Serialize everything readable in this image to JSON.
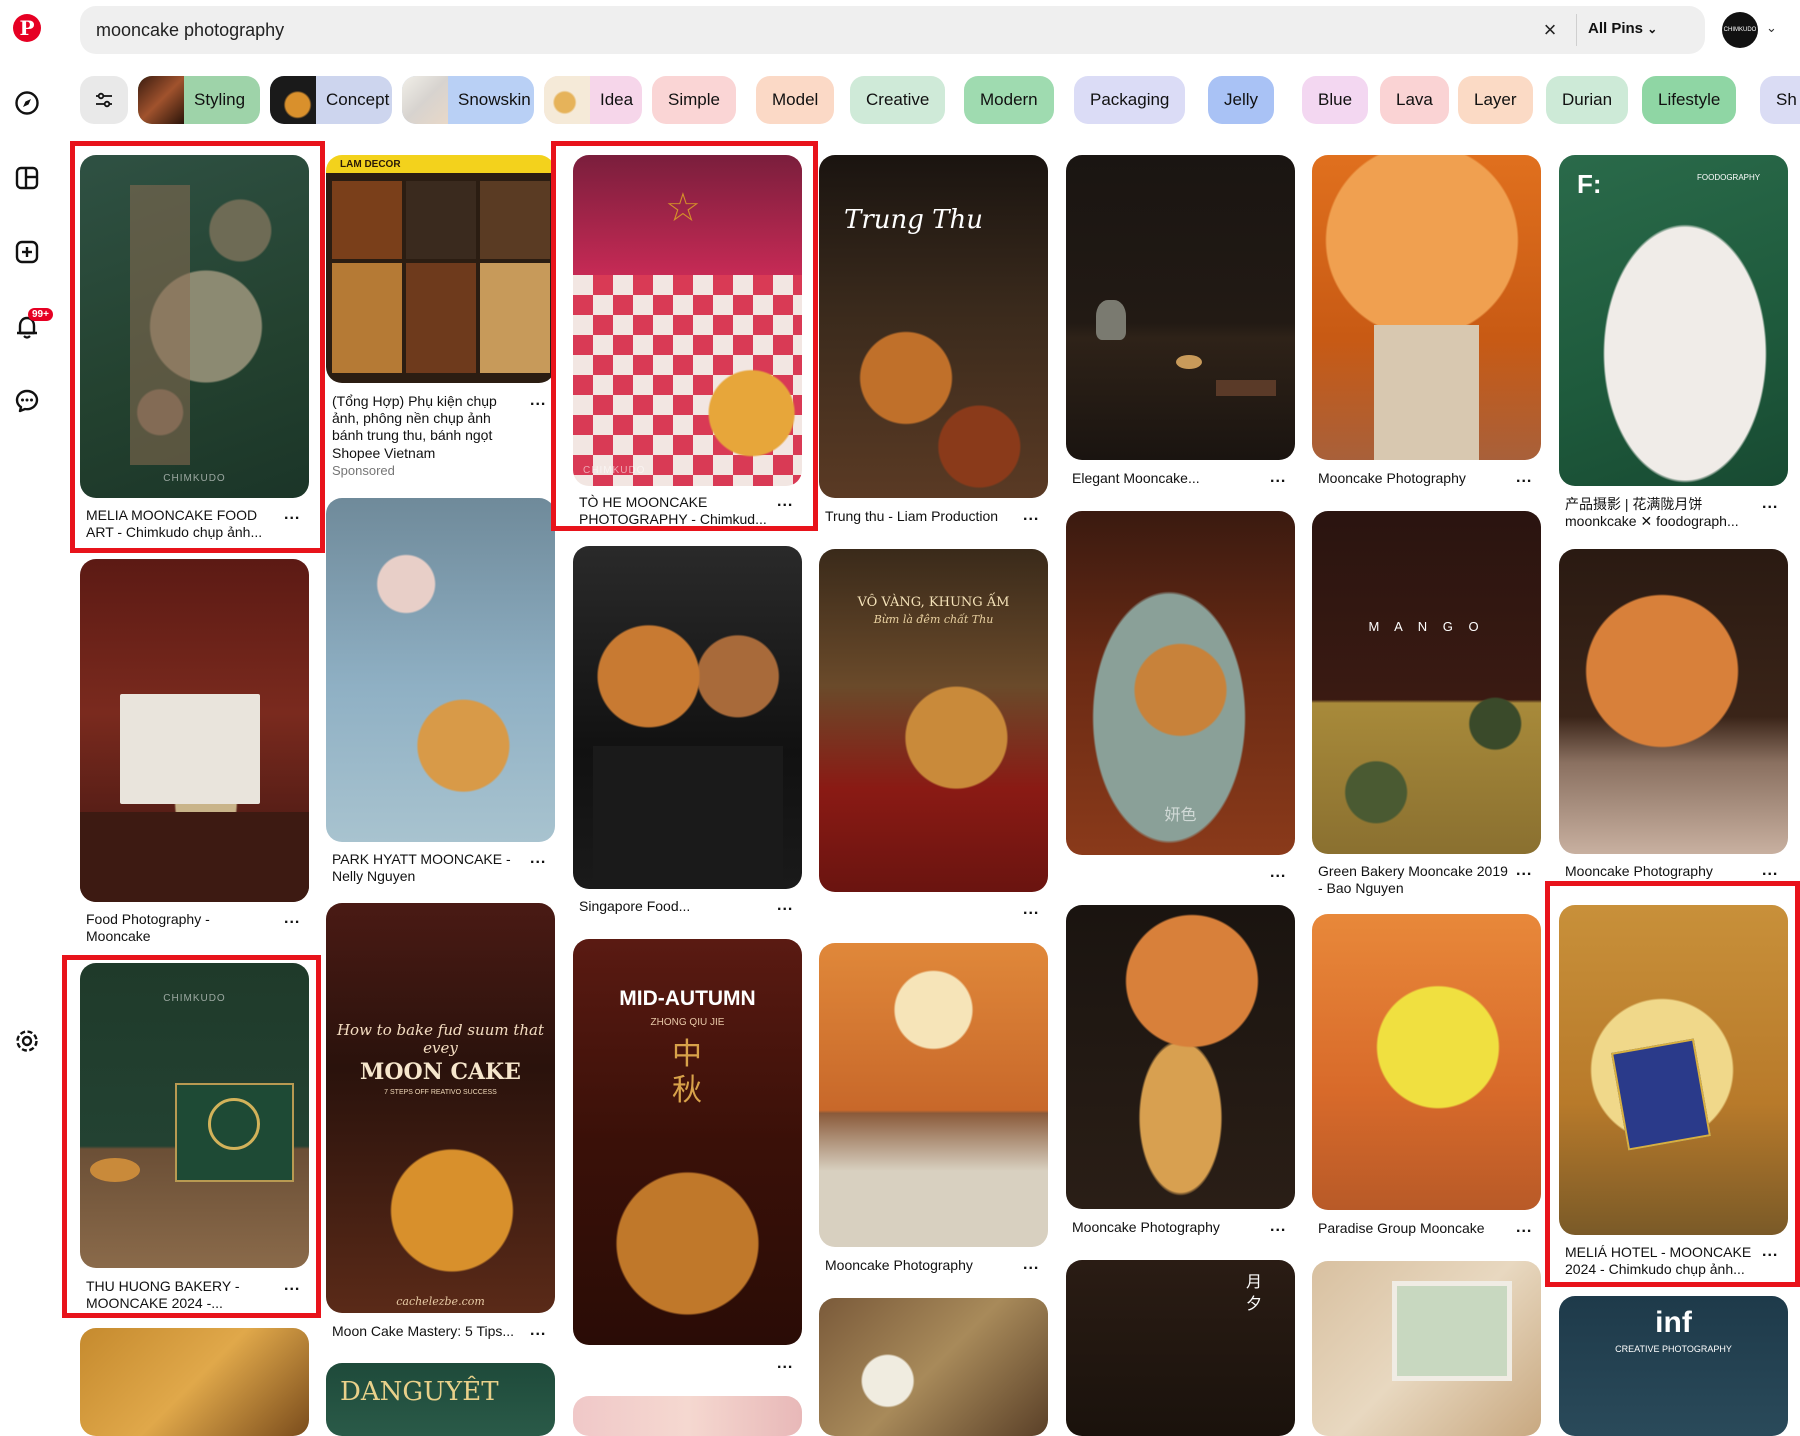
{
  "sidebar": {
    "logo": "P",
    "items": [
      "explore-icon",
      "boards-icon",
      "create-icon",
      "notifications-icon",
      "messages-icon",
      "settings-icon"
    ],
    "notification_badge": "99+"
  },
  "header": {
    "search_query": "mooncake photography",
    "clear_icon": "×",
    "filter_label": "All Pins",
    "avatar_text": "CHIMKUDO"
  },
  "chips": [
    {
      "label": "Styling",
      "color": "#9ed3a9"
    },
    {
      "label": "Concept",
      "color": "#cdd5ee"
    },
    {
      "label": "Snowskin",
      "color": "#b9d0f5"
    },
    {
      "label": "Idea",
      "color": "#f6d6ea"
    },
    {
      "label": "Simple",
      "color": "#fad5d5"
    },
    {
      "label": "Model",
      "color": "#fbd9c6"
    },
    {
      "label": "Creative",
      "color": "#cfead8"
    },
    {
      "label": "Modern",
      "color": "#9fdbb0"
    },
    {
      "label": "Packaging",
      "color": "#dbdcf6"
    },
    {
      "label": "Jelly",
      "color": "#a9c2f5"
    },
    {
      "label": "Blue",
      "color": "#f3d7f1"
    },
    {
      "label": "Lava",
      "color": "#fad3d4"
    },
    {
      "label": "Layer",
      "color": "#fbdac5"
    },
    {
      "label": "Durian",
      "color": "#cdead7"
    },
    {
      "label": "Lifestyle",
      "color": "#8fd6a4"
    },
    {
      "label": "Sh",
      "color": "#dadcf4"
    }
  ],
  "pins": {
    "c1p1": {
      "title": "MELIA MOONCAKE FOOD ART - Chimkudo chụp ảnh...",
      "watermark": "CHIMKUDO"
    },
    "c1p2": {
      "title": "Food Photography - Mooncake"
    },
    "c1p3": {
      "title": "THU HUONG BAKERY - MOONCAKE 2024 -...",
      "watermark": "CHIMKUDO"
    },
    "c2p1": {
      "title": "(Tổng Hợp) Phụ kiện chụp ảnh, phông nền chụp ảnh bánh trung thu, bánh ngọt",
      "brand": "Shopee Vietnam",
      "sponsored": "Sponsored",
      "overlay": "LAM DECOR"
    },
    "c2p2": {
      "title": "PARK HYATT MOONCAKE - Nelly Nguyen"
    },
    "c2p3": {
      "title": "Moon Cake Mastery: 5 Tips...",
      "overlay_script": "How to bake fud suum that evey",
      "overlay_main": "MOON CAKE",
      "overlay_small": "7 STEPS OFF REATIVO SUCCESS",
      "overlay_url": "cachelezbe.com"
    },
    "c2p4": {
      "overlay": "DANGUYÊT"
    },
    "c3p1": {
      "title": "TÒ HE MOONCAKE PHOTOGRAPHY - Chimkud...",
      "watermark": "CHIMKUDO"
    },
    "c3p2": {
      "title": "Singapore Food..."
    },
    "c3p3": {
      "overlay_main": "MID-AUTUMN",
      "overlay_sub": "ZHONG QIU JIE",
      "overlay_cn": "中秋"
    },
    "c4p1": {
      "title": "Trung thu - Liam Production",
      "overlay": "Trung Thu"
    },
    "c4p2": {
      "overlay_main": "VÔ VÀNG, KHUNG ẤM",
      "overlay_sub": "Bừm là đêm chất Thu"
    },
    "c4p3": {
      "title": "Mooncake Photography"
    },
    "c5p1": {
      "title": "Elegant Mooncake..."
    },
    "c5p2": {
      "overlay": "妍色"
    },
    "c5p3": {
      "title": "Mooncake Photography"
    },
    "c5p4": {
      "overlay": "月 夕"
    },
    "c6p1": {
      "title": "Mooncake Photography"
    },
    "c6p2": {
      "title": "Green Bakery Mooncake 2019 - Bao Nguyen",
      "overlay": "M A N G O"
    },
    "c6p3": {
      "title": "Paradise Group Mooncake"
    },
    "c7p1": {
      "title": "产品摄影 | 花满陇月饼 moonkcake ✕ foodograph...",
      "overlay": "F:",
      "overlay_brand": "FOODOGRAPHY"
    },
    "c7p2": {
      "title": "Mooncake Photography"
    },
    "c7p3": {
      "title": "MELIÁ HOTEL - MOONCAKE 2024 - Chimkudo chụp ảnh..."
    },
    "c7p4": {
      "overlay": "inf",
      "overlay_sub": "CREATIVE PHOTOGRAPHY"
    }
  },
  "more_label": "...",
  "colors": {
    "brand": "#e60023",
    "highlight": "#e8131b"
  }
}
